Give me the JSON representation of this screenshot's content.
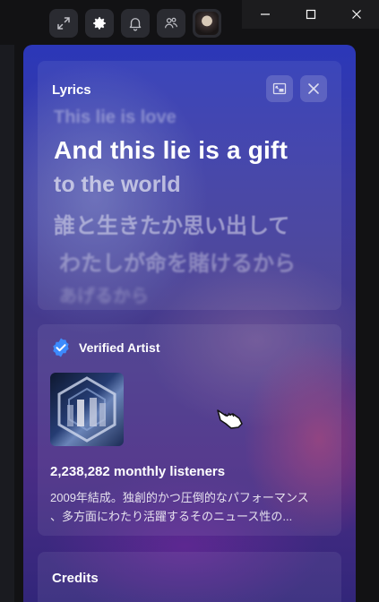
{
  "lyrics": {
    "title": "Lyrics",
    "lines": [
      "This lie is love",
      "And this lie is a gift",
      "to the world",
      "誰と生きたか思い出して",
      "わたしが命を賭けるから",
      "あげるから"
    ]
  },
  "artist": {
    "verified_label": "Verified Artist",
    "monthly_listeners": "2,238,282 monthly listeners",
    "bio_line1": "2009年結成。独創的かつ圧倒的なパフォーマンス",
    "bio_line2": "、多方面にわたり活躍するそのニュース性の..."
  },
  "credits": {
    "title": "Credits"
  },
  "colors": {
    "verified_badge": "#3d8bfd",
    "toolbar_button_bg": "#2a2b31"
  },
  "icons": {
    "toolbar": [
      "expand-icon",
      "gear-icon",
      "bell-icon",
      "friends-icon",
      "avatar"
    ],
    "window": [
      "minimize-icon",
      "maximize-icon",
      "close-icon"
    ],
    "lyrics_actions": [
      "picture-in-picture-icon",
      "close-icon"
    ]
  }
}
